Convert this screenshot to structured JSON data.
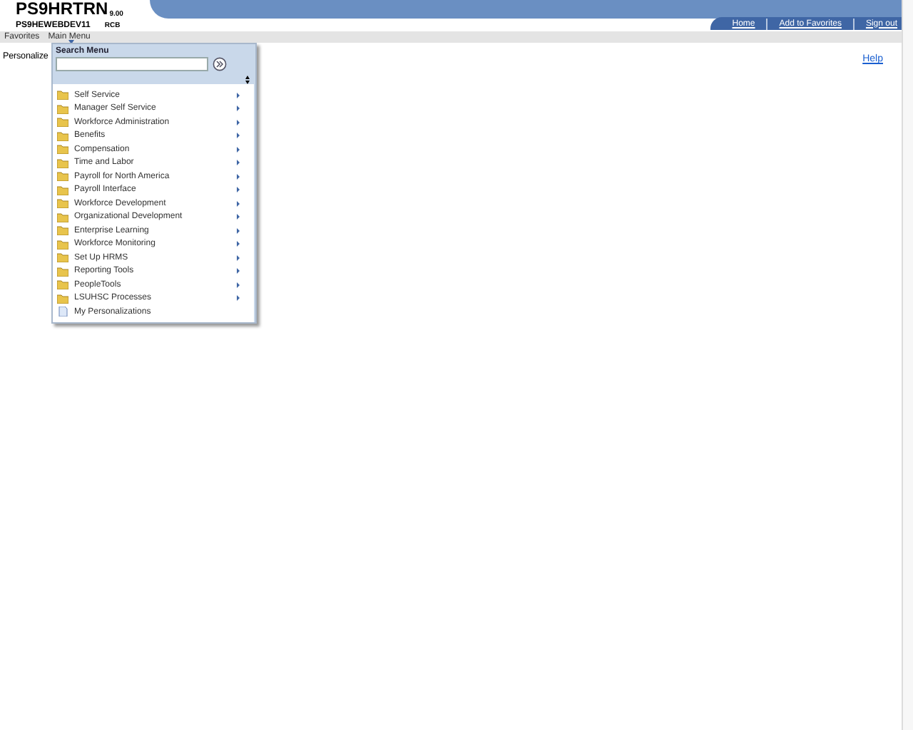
{
  "header": {
    "product": "PS9HRTRN",
    "version": "9.00",
    "database": "PS9HEWEBDEV11",
    "user": "RCB",
    "links": [
      "Home",
      "Add to Favorites",
      "Sign out"
    ]
  },
  "menu_bar": [
    {
      "label": "Favorites",
      "selected": false
    },
    {
      "label": "Main Menu",
      "selected": true
    }
  ],
  "page": {
    "title": "Personalize",
    "help": "Help"
  },
  "dropdown": {
    "title": "Search Menu",
    "items": [
      {
        "label": "Self Service",
        "kind": "folder"
      },
      {
        "label": "Manager Self Service",
        "kind": "folder"
      },
      {
        "label": "Workforce Administration",
        "kind": "folder"
      },
      {
        "label": "Benefits",
        "kind": "folder"
      },
      {
        "label": "Compensation",
        "kind": "folder"
      },
      {
        "label": "Time and Labor",
        "kind": "folder"
      },
      {
        "label": "Payroll for North America",
        "kind": "folder"
      },
      {
        "label": "Payroll Interface",
        "kind": "folder"
      },
      {
        "label": "Workforce Development",
        "kind": "folder"
      },
      {
        "label": "Organizational Development",
        "kind": "folder"
      },
      {
        "label": "Enterprise Learning",
        "kind": "folder"
      },
      {
        "label": "Workforce Monitoring",
        "kind": "folder"
      },
      {
        "label": "Set Up HRMS",
        "kind": "folder"
      },
      {
        "label": "Reporting Tools",
        "kind": "folder"
      },
      {
        "label": "PeopleTools",
        "kind": "folder"
      },
      {
        "label": "LSUHSC Processes",
        "kind": "folder"
      },
      {
        "label": "My Personalizations",
        "kind": "page"
      }
    ]
  }
}
